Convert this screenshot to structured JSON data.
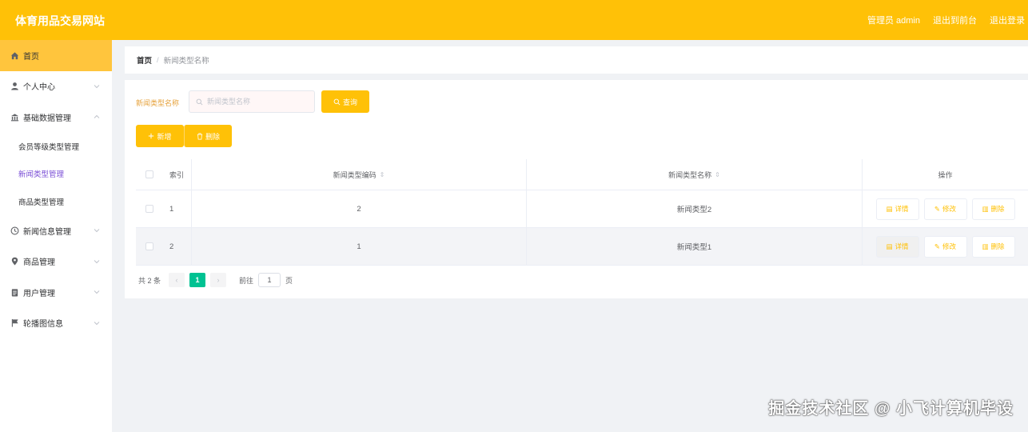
{
  "header": {
    "title": "体育用品交易网站",
    "admin_label": "管理员 admin",
    "back_label": "退出到前台",
    "logout_label": "退出登录"
  },
  "sidebar": {
    "items": [
      {
        "label": "首页",
        "icon": "home-icon"
      },
      {
        "label": "个人中心",
        "icon": "user-icon"
      },
      {
        "label": "基础数据管理",
        "icon": "bank-icon"
      },
      {
        "label": "会员等级类型管理"
      },
      {
        "label": "新闻类型管理"
      },
      {
        "label": "商品类型管理"
      },
      {
        "label": "新闻信息管理",
        "icon": "clock-icon"
      },
      {
        "label": "商品管理",
        "icon": "location-icon"
      },
      {
        "label": "用户管理",
        "icon": "clipboard-icon"
      },
      {
        "label": "轮播图信息",
        "icon": "flag-icon"
      }
    ]
  },
  "breadcrumb": {
    "home": "首页",
    "separator": "/",
    "current": "新闻类型名称"
  },
  "search": {
    "label": "新闻类型名称",
    "placeholder": "新闻类型名称",
    "query_label": "查询"
  },
  "toolbar": {
    "add_label": "新增",
    "delete_label": "删除"
  },
  "table": {
    "headers": {
      "index": "索引",
      "code": "新闻类型编码",
      "name": "新闻类型名称",
      "ops": "操作"
    },
    "rows": [
      {
        "index": "1",
        "code": "2",
        "name": "新闻类型2"
      },
      {
        "index": "2",
        "code": "1",
        "name": "新闻类型1"
      }
    ],
    "op_labels": {
      "detail": "详情",
      "edit": "修改",
      "delete": "删除"
    }
  },
  "pagination": {
    "total": "共 2 条",
    "current_page": "1",
    "goto_label": "前往",
    "goto_value": "1",
    "page_unit": "页"
  },
  "watermark": "掘金技术社区 @ 小飞计算机毕设",
  "colors": {
    "brand": "#ffc107",
    "active_menu": "#ffc53d",
    "pager_active": "#00c292",
    "sub_active": "#7b4fd6"
  }
}
